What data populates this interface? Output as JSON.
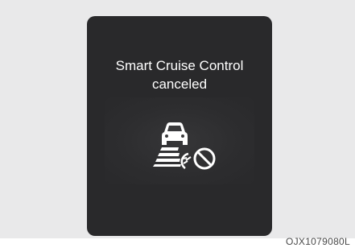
{
  "display": {
    "message_line1": "Smart Cruise Control",
    "message_line2": "canceled",
    "icon": "smart-cruise-control-canceled-icon"
  },
  "figure_code": "OJX1079080L",
  "colors": {
    "background": "#e9e9ea",
    "panel": "#29292b",
    "text": "#ffffff"
  }
}
